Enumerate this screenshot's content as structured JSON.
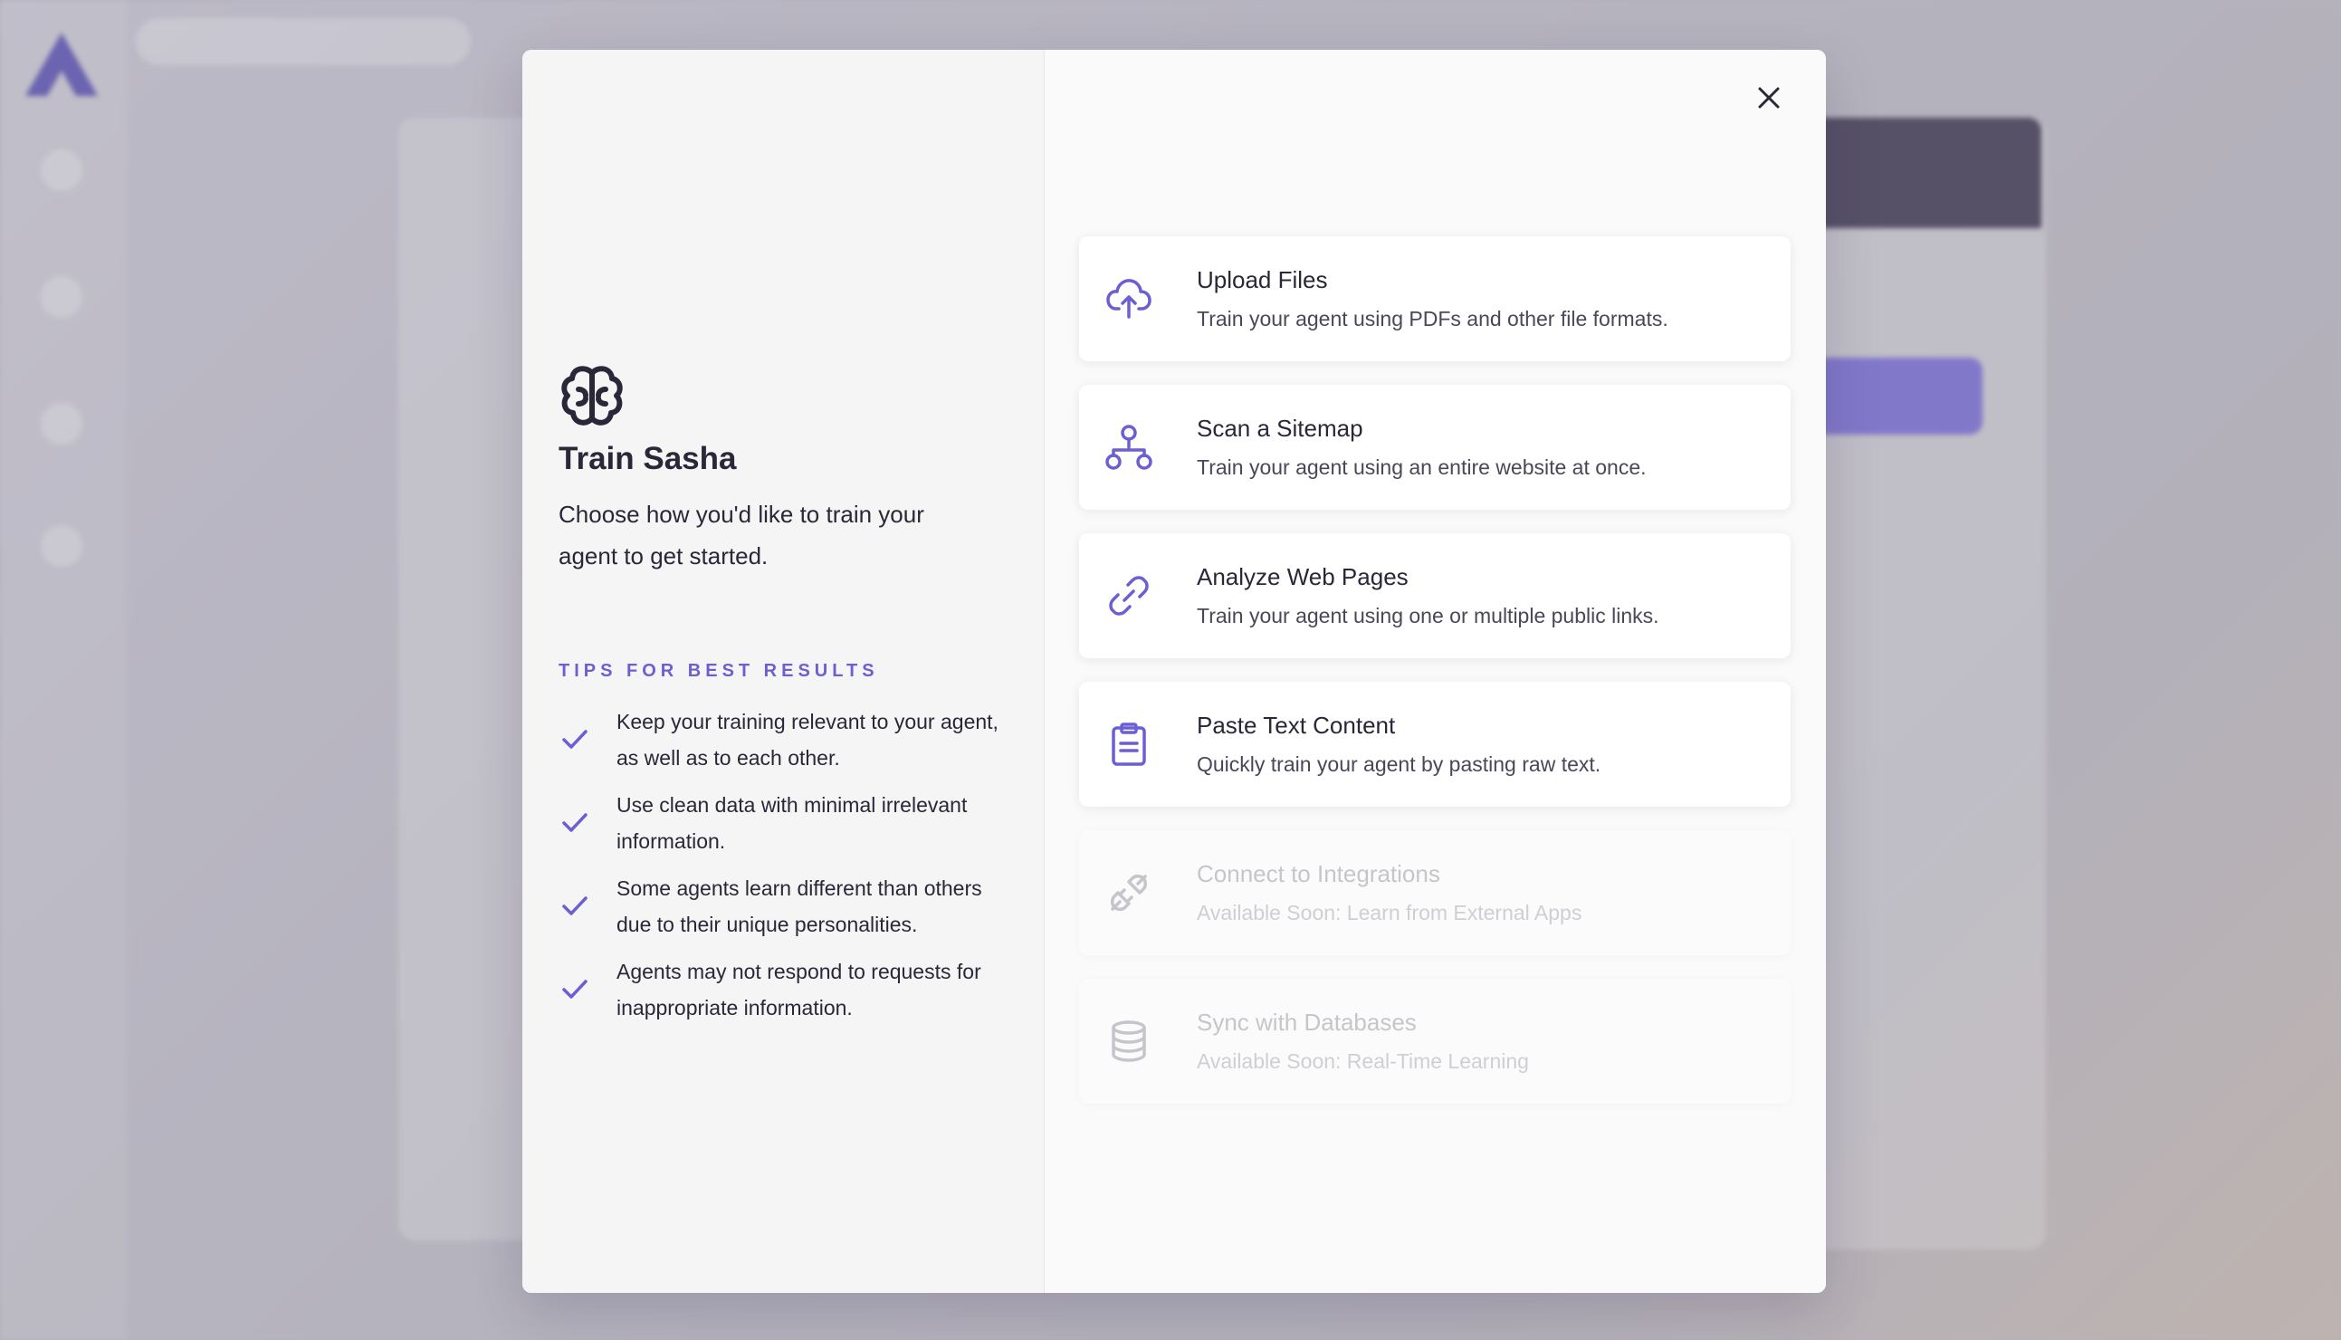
{
  "modal": {
    "title": "Train Sasha",
    "subtitle": "Choose how you'd like to train your agent to get started.",
    "tips_heading": "TIPS FOR BEST RESULTS",
    "tips": [
      "Keep your training relevant to your agent, as well as to each other.",
      "Use clean data with minimal irrelevant information.",
      "Some agents learn different than others due to their unique personalities.",
      "Agents may not respond to requests for inappropriate information."
    ],
    "options": [
      {
        "title": "Upload Files",
        "desc": "Train your agent using PDFs and other file formats.",
        "icon": "cloud-upload-icon",
        "enabled": true
      },
      {
        "title": "Scan a Sitemap",
        "desc": "Train your agent using an entire website at once.",
        "icon": "sitemap-icon",
        "enabled": true
      },
      {
        "title": "Analyze Web Pages",
        "desc": "Train your agent using one or multiple public links.",
        "icon": "link-icon",
        "enabled": true
      },
      {
        "title": "Paste Text Content",
        "desc": "Quickly train your agent by pasting raw text.",
        "icon": "clipboard-icon",
        "enabled": true
      },
      {
        "title": "Connect to Integrations",
        "desc": "Available Soon: Learn from External Apps",
        "icon": "plug-icon",
        "enabled": false
      },
      {
        "title": "Sync with Databases",
        "desc": "Available Soon: Real-Time Learning",
        "icon": "database-icon",
        "enabled": false
      }
    ]
  },
  "colors": {
    "accent": "#6b5fd3",
    "text": "#2a2838",
    "disabled": "#c6c5cc"
  }
}
